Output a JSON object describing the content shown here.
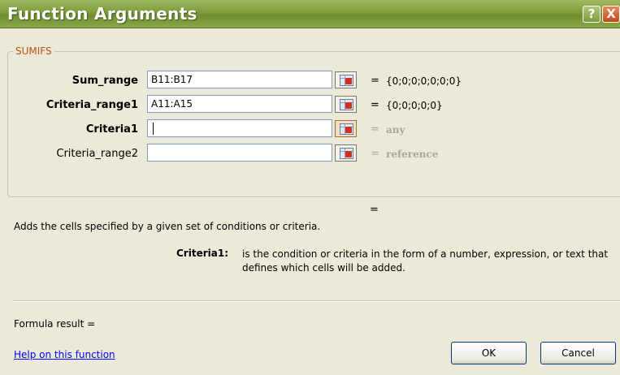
{
  "window": {
    "title": "Function Arguments",
    "help_glyph": "?",
    "close_glyph": "X"
  },
  "group": {
    "label": "SUMIFS"
  },
  "arguments": [
    {
      "label": "Sum_range",
      "value": "B11:B17",
      "result": "{0;0;0;0;0;0;0}"
    },
    {
      "label": "Criteria_range1",
      "value": "A11:A15",
      "result": "{0;0;0;0;0}"
    },
    {
      "label": "Criteria1",
      "value": "",
      "result": "any"
    },
    {
      "label": "Criteria_range2",
      "value": "",
      "result": "reference"
    }
  ],
  "equals": "=",
  "description": "Adds the cells specified by a given set of conditions or criteria.",
  "argument_help": {
    "name": "Criteria1:",
    "text": "is the condition or criteria in the form of a number, expression, or text that defines which cells will be added."
  },
  "formula_result": "Formula result =",
  "help_link": "Help on this function",
  "buttons": {
    "ok": "OK",
    "cancel": "Cancel"
  }
}
